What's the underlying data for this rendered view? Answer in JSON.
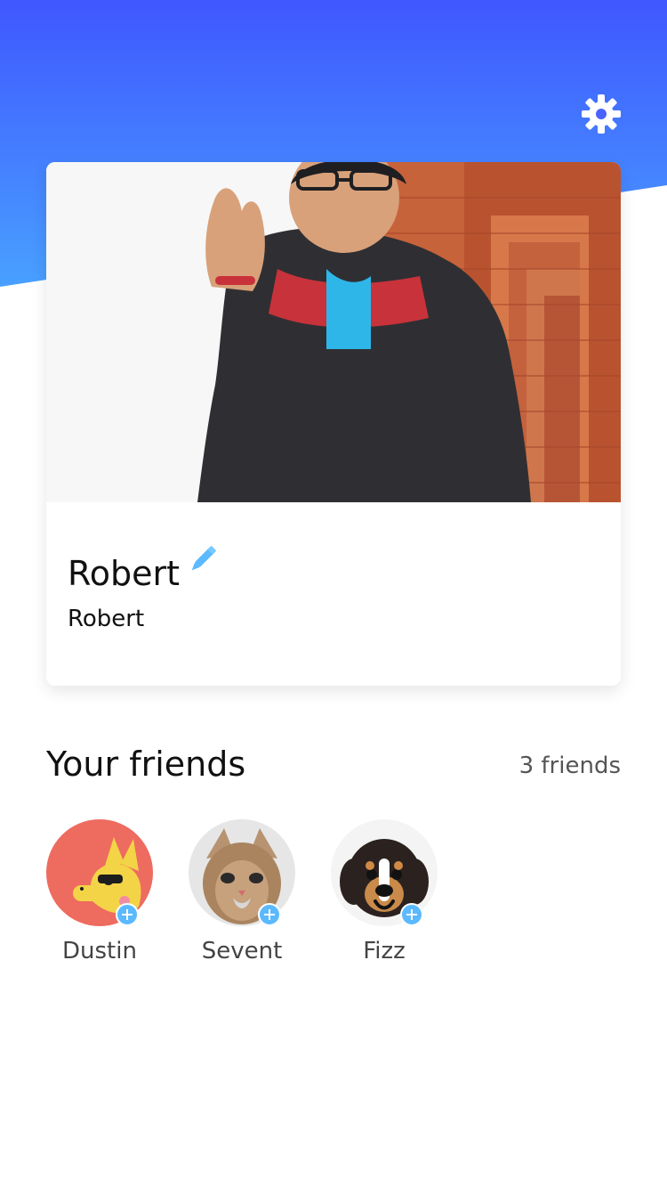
{
  "header": {
    "colors": {
      "gradient_top": "#3f57ff",
      "gradient_bottom": "#49a2ff"
    },
    "settings_icon": "gear-icon"
  },
  "profile": {
    "photo": "profile-photo",
    "name": "Robert",
    "username": "Robert",
    "edit_icon": "pencil-icon",
    "accent_color": "#5ab9ff"
  },
  "friends": {
    "title": "Your friends",
    "count_label": "3 friends",
    "items": [
      {
        "name": "Dustin",
        "avatar": "dustin-avatar",
        "add_icon": "plus-icon"
      },
      {
        "name": "Sevent",
        "avatar": "sevent-avatar",
        "add_icon": "plus-icon"
      },
      {
        "name": "Fizz",
        "avatar": "fizz-avatar",
        "add_icon": "plus-icon"
      }
    ]
  }
}
